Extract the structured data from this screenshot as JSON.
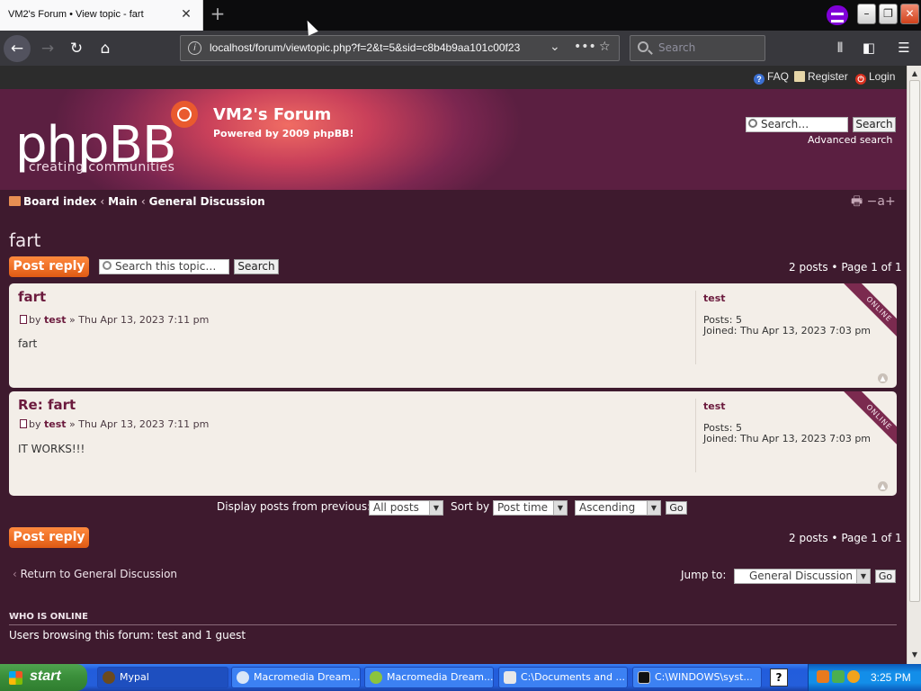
{
  "browser": {
    "tab_title": "VM2's Forum • View topic - fart",
    "url": "localhost/forum/viewtopic.php?f=2&t=5&sid=c8b4b9aa101c00f23",
    "search_placeholder": "Search"
  },
  "topnav": {
    "faq": "FAQ",
    "register": "Register",
    "login": "Login"
  },
  "header": {
    "logo": "phpBB",
    "logo_tagline": "creating   communities",
    "site_title": "VM2's Forum",
    "site_desc": "Powered by 2009 phpBB!",
    "search_value": "Search…",
    "search_button": "Search",
    "advanced_search": "Advanced search"
  },
  "breadcrumb": {
    "items": [
      "Board index",
      "Main",
      "General Discussion"
    ],
    "separator": "‹"
  },
  "topic": {
    "title": "fart",
    "post_reply": "Post reply",
    "search_placeholder": "Search this topic…",
    "search_button": "Search",
    "pagination": "2 posts • Page 1 of 1"
  },
  "posts": [
    {
      "title": "fart",
      "by": "by",
      "author": "test",
      "date": "» Thu Apr 13, 2023 7:11 pm",
      "body": "fart",
      "profile_name": "test",
      "posts_line": "Posts: 5",
      "joined_line": "Joined: Thu Apr 13, 2023 7:03 pm",
      "status": "ONLINE"
    },
    {
      "title": "Re: fart",
      "by": "by",
      "author": "test",
      "date": "» Thu Apr 13, 2023 7:11 pm",
      "body": "IT WORKS!!!",
      "profile_name": "test",
      "posts_line": "Posts: 5",
      "joined_line": "Joined: Thu Apr 13, 2023 7:03 pm",
      "status": "ONLINE"
    }
  ],
  "display_options": {
    "display_label": "Display posts from previous:",
    "display_value": "All posts",
    "sort_label": "Sort by",
    "sort_value": "Post time",
    "order_value": "Ascending",
    "go": "Go"
  },
  "footer": {
    "return_link": "Return to General Discussion",
    "jump_label": "Jump to:",
    "jump_value": "General Discussion",
    "go": "Go",
    "who_is_online_title": "WHO IS ONLINE",
    "who_is_online_text": "Users browsing this forum: test and 1 guest"
  },
  "taskbar": {
    "start": "start",
    "tasks": [
      "Mypal",
      "Macromedia Dream...",
      "Macromedia Dream...",
      "C:\\Documents and ...",
      "C:\\WINDOWS\\syst..."
    ],
    "help": "?",
    "clock": "3:25 PM"
  },
  "colors": {
    "page_bg": "#3e1a2e",
    "post_bg": "#f3eee8",
    "accent": "#df5a14",
    "link": "#6b1a3d"
  }
}
